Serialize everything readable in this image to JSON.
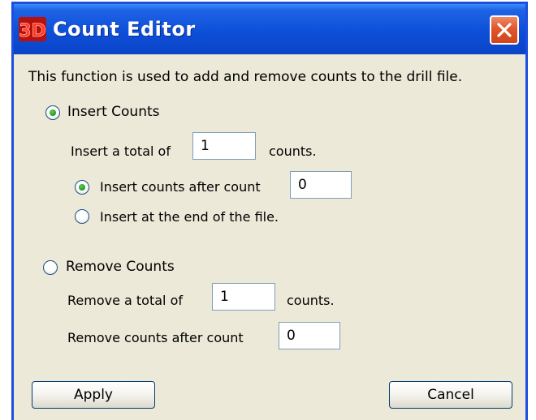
{
  "dialog": {
    "title": "Count Editor",
    "description": "This function is used to add and remove counts to the drill file."
  },
  "insert": {
    "radio_label": "Insert Counts",
    "selected": true,
    "total_prefix": "Insert a total of",
    "total_value": "1",
    "total_suffix": "counts.",
    "after_label": "Insert counts after count",
    "after_selected": true,
    "after_value": "0",
    "end_label": "Insert at the end of the file.",
    "end_selected": false
  },
  "remove": {
    "radio_label": "Remove Counts",
    "selected": false,
    "total_prefix": "Remove a total of",
    "total_value": "1",
    "total_suffix": "counts.",
    "after_label": "Remove counts after count",
    "after_value": "0"
  },
  "buttons": {
    "apply": "Apply",
    "cancel": "Cancel"
  },
  "icons": {
    "app": "3d-logo-icon",
    "close": "close-icon"
  },
  "colors": {
    "titlebar": "#0a44c8",
    "close_button": "#e0552b",
    "dialog_background": "#ece9d8",
    "radio_checked": "#22a022"
  }
}
